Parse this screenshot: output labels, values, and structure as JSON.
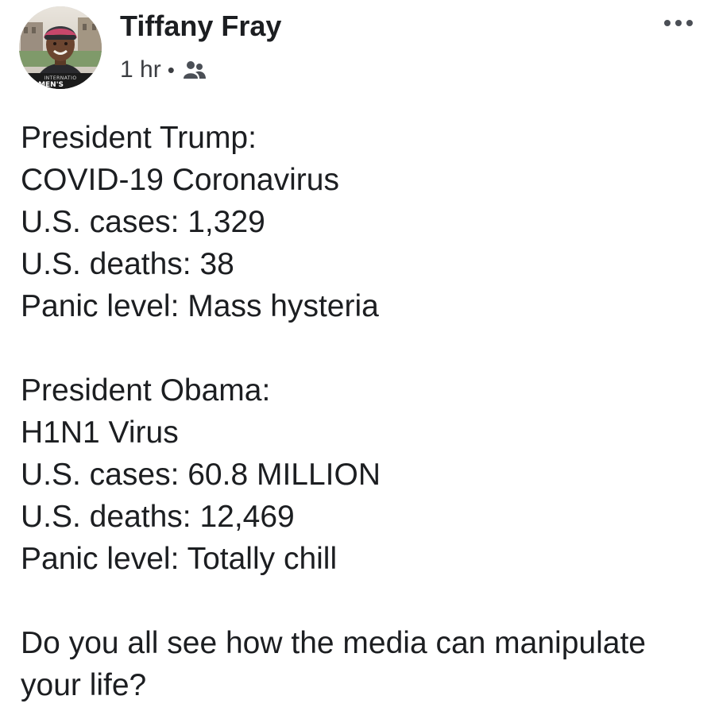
{
  "post": {
    "author": {
      "name": "Tiffany Fray",
      "avatar_caption": "INTERNATIONAL MEN'S"
    },
    "meta": {
      "time": "1 hr",
      "separator": "•",
      "audience_icon": "friends-icon"
    },
    "more_icon": "more-options-icon",
    "paragraphs": [
      {
        "lines": [
          "President Trump:",
          "COVID-19 Coronavirus",
          "U.S. cases: 1,329",
          "U.S. deaths: 38",
          "Panic level: Mass hysteria"
        ]
      },
      {
        "lines": [
          "President Obama:",
          "H1N1 Virus",
          "U.S. cases: 60.8 MILLION",
          "U.S. deaths: 12,469",
          "Panic level: Totally chill"
        ]
      },
      {
        "lines": [
          "Do you all see how the media can manipulate",
          "your life?"
        ]
      }
    ]
  }
}
